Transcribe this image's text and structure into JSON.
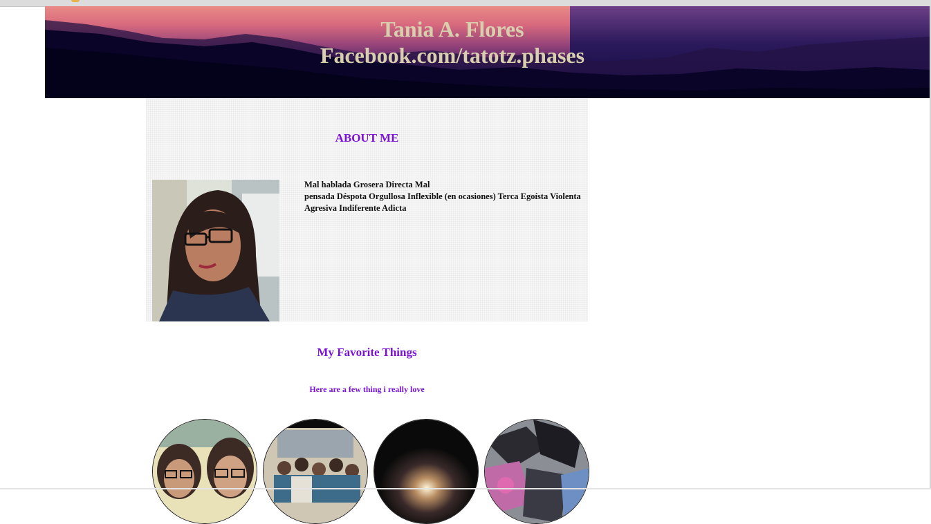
{
  "header": {
    "name": "Tania A. Flores",
    "link": "Facebook.com/tatotz.phases"
  },
  "about": {
    "heading": "ABOUT ME",
    "description_line1": "Mal hablada Grosera Directa Mal",
    "description_line2": "pensada Déspota Orgullosa Inflexible (en ocasiones) Terca Egoísta Violenta Agresiva Indiferente Adicta"
  },
  "favorites": {
    "heading": "My Favorite Things",
    "subheading": "Here are a few thing i really love"
  },
  "colors": {
    "accent": "#7a12d6",
    "title_text": "#d9cfae"
  }
}
